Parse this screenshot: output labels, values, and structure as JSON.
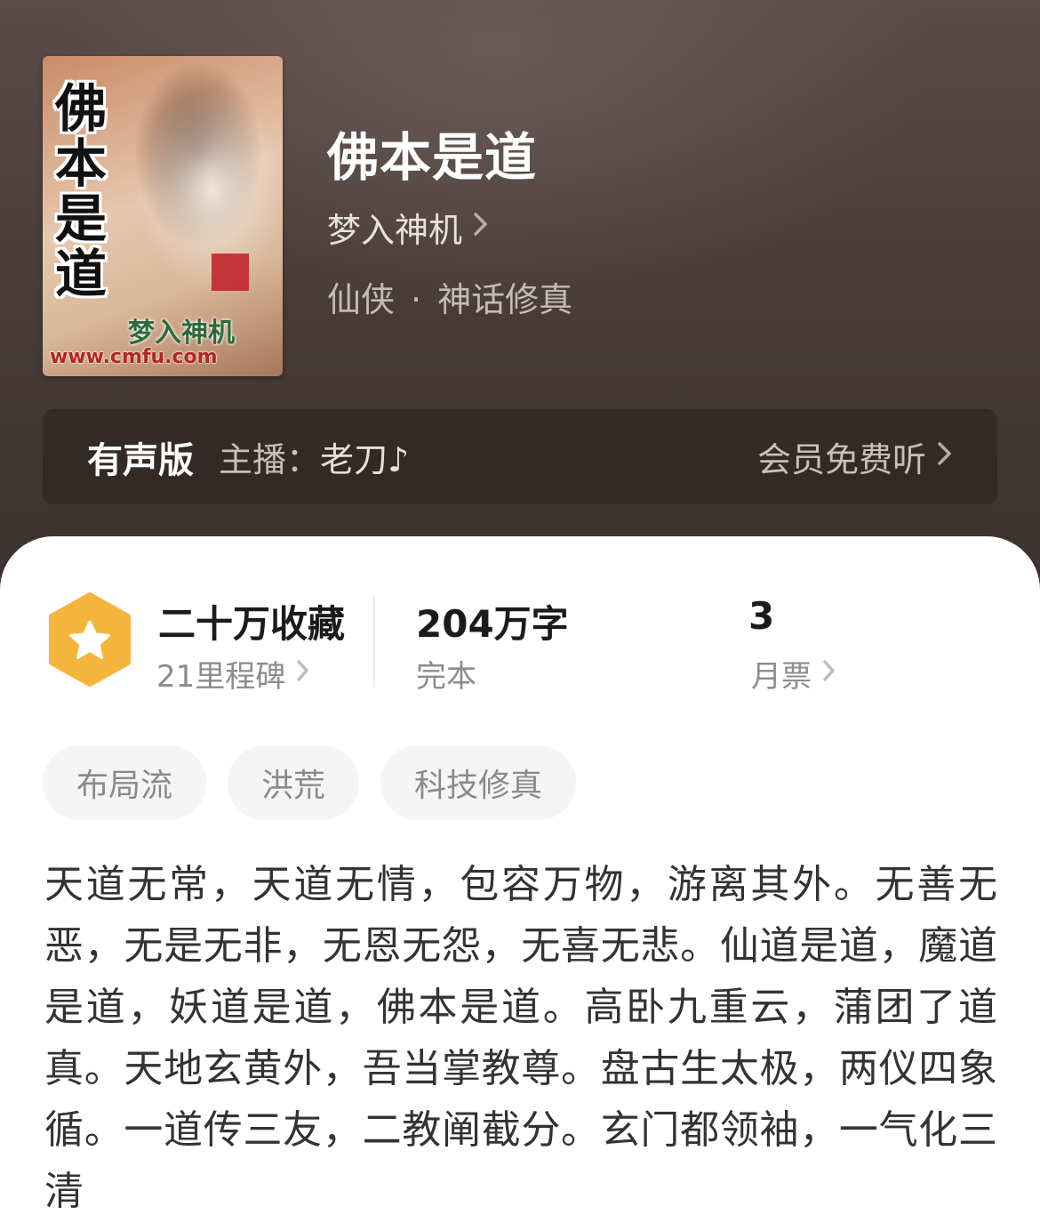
{
  "book": {
    "title": "佛本是道",
    "author": "梦入神机",
    "category": "仙侠",
    "subcategory": "神话修真",
    "separator": "·"
  },
  "cover": {
    "title_chars": [
      "佛",
      "本",
      "是",
      "道"
    ],
    "author_text": "梦入神机",
    "url_text": "www.cmfu.com"
  },
  "audio": {
    "label": "有声版",
    "host_prefix": "主播：",
    "host_name": "老刀♪",
    "cta": "会员免费听"
  },
  "stats": {
    "collection": "二十万收藏",
    "milestone": "21里程碑",
    "word_count": "204万字",
    "status": "完本",
    "monthly_votes": "3",
    "monthly_label": "月票"
  },
  "tags": [
    "布局流",
    "洪荒",
    "科技修真"
  ],
  "synopsis": "天道无常，天道无情，包容万物，游离其外。无善无恶，无是无非，无恩无怨，无喜无悲。仙道是道，魔道是道，妖道是道，佛本是道。高卧九重云，蒲团了道真。天地玄黄外，吾当掌教尊。盘古生太极，两仪四象循。一道传三友，二教阐截分。玄门都领袖，一气化三清",
  "colors": {
    "badge": "#f5b53c",
    "header_bg": "#4a3d39",
    "card_bg": "#ffffff"
  },
  "icons": {
    "chevron": "chevron-right-icon",
    "badge": "star-hexagon-icon"
  }
}
